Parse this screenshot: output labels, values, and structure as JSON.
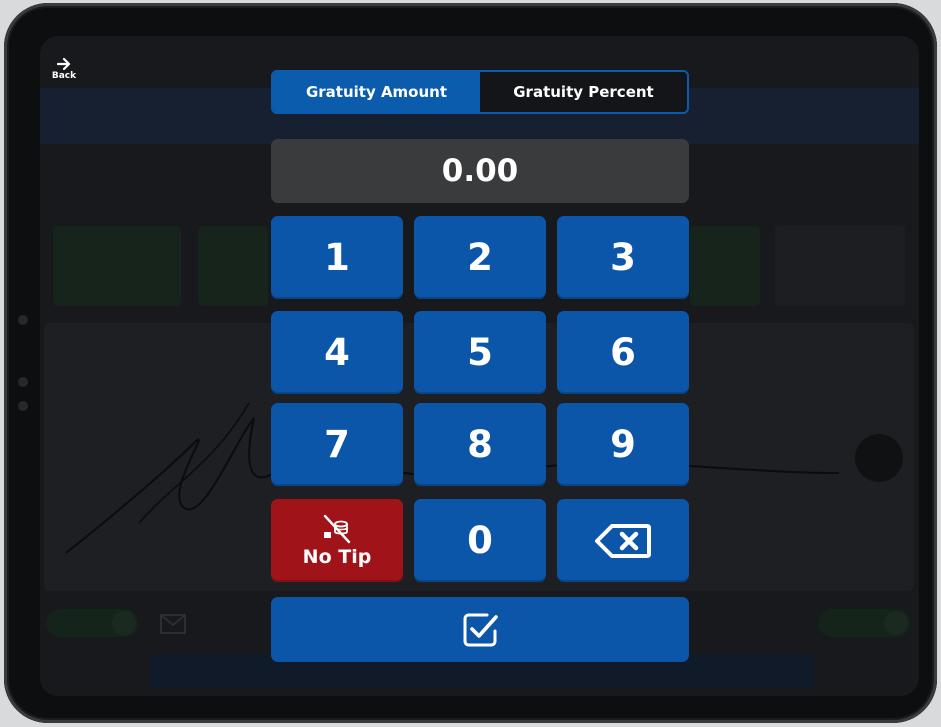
{
  "header": {
    "back_label": "Back"
  },
  "tabs": [
    {
      "label": "Gratuity Amount",
      "active": true
    },
    {
      "label": "Gratuity Percent",
      "active": false
    }
  ],
  "amount_display": "0.00",
  "keypad": {
    "keys": [
      "1",
      "2",
      "3",
      "4",
      "5",
      "6",
      "7",
      "8",
      "9"
    ],
    "no_tip_label": "No Tip",
    "zero": "0"
  },
  "colors": {
    "primary_blue": "#0b56a8",
    "no_tip_red": "#a01419",
    "display_gray": "#3a3b3d"
  },
  "icons": {
    "back": "arrow-right-icon",
    "no_tip": "no-tip-icon",
    "backspace": "backspace-icon",
    "confirm": "checkbox-check-icon"
  }
}
